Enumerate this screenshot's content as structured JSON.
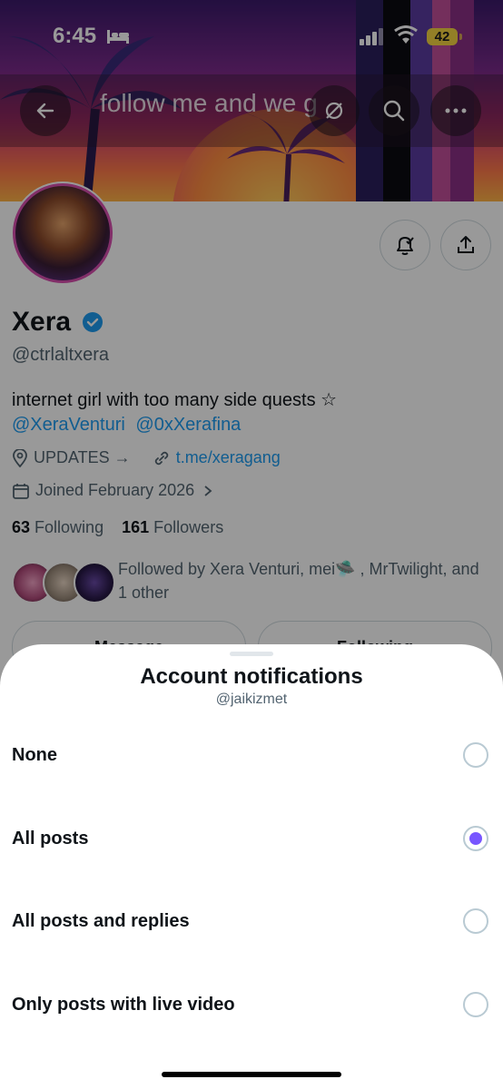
{
  "status_bar": {
    "time": "6:45",
    "battery": "42"
  },
  "nav": {
    "title": "follow me and we g"
  },
  "profile": {
    "name": "Xera",
    "handle": "@ctrlaltxera",
    "bio": "internet girl with too many side quests ☆",
    "bio_mentions": [
      "@XeraVenturi",
      "@0xXerafina"
    ],
    "location": "UPDATES →",
    "website": "t.me/xeragang",
    "joined": "Joined February 2026",
    "following_count": "63",
    "following_label": "Following",
    "followers_count": "161",
    "followers_label": "Followers",
    "followed_by": "Followed by Xera Venturi, mei🛸 , MrTwilight, and 1 other",
    "message_button": "Message",
    "following_button": "Following"
  },
  "sheet": {
    "title": "Account notifications",
    "subtitle": "@jaikizmet",
    "options": [
      {
        "label": "None",
        "selected": false
      },
      {
        "label": "All posts",
        "selected": true
      },
      {
        "label": "All posts and replies",
        "selected": false
      },
      {
        "label": "Only posts with live video",
        "selected": false
      }
    ]
  },
  "colors": {
    "accent": "#7856ff",
    "link": "#1d9bf0"
  }
}
